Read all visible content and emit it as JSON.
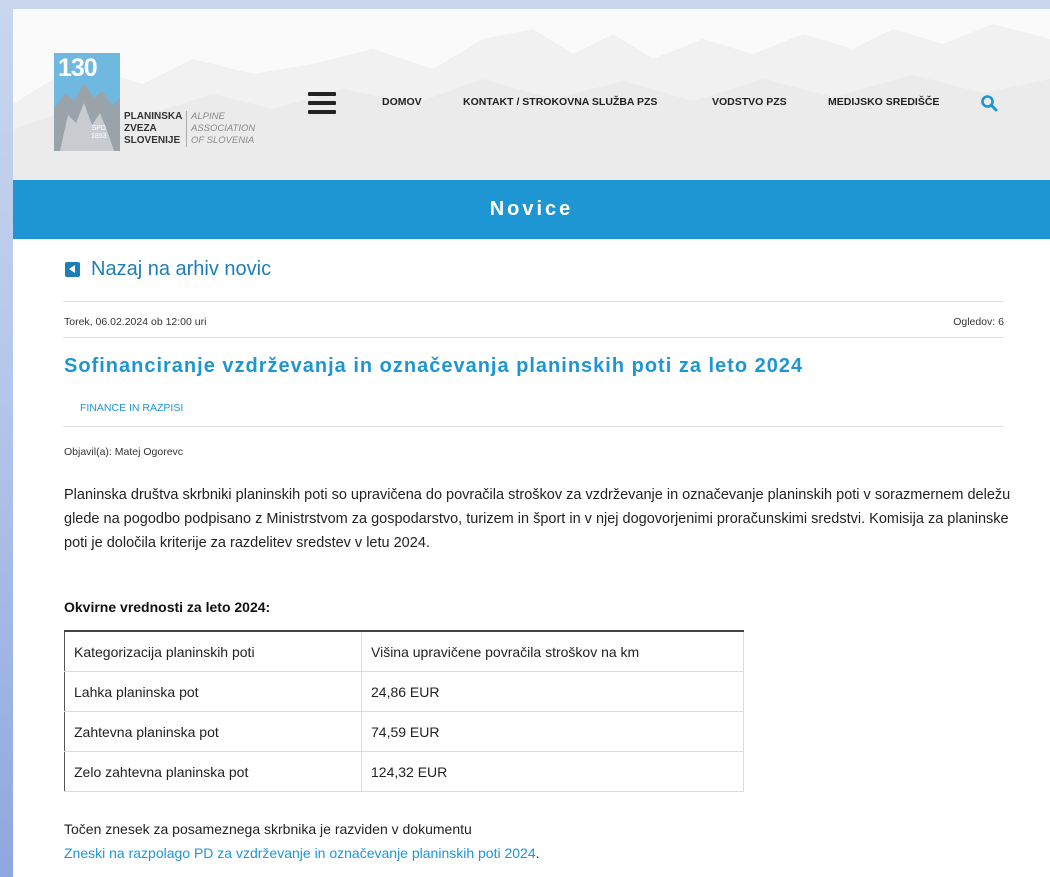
{
  "logo": {
    "number": "130",
    "spd": "SPD",
    "spd_year": "1893",
    "name_lines": [
      "PLANINSKA",
      "ZVEZA",
      "SLOVENIJE"
    ],
    "sub_lines": [
      "ALPINE",
      "ASSOCIATION",
      "OF SLOVENIA"
    ]
  },
  "nav": {
    "items": [
      "DOMOV",
      "KONTAKT / STROKOVNA SLUŽBA PZS",
      "VODSTVO PZS",
      "MEDIJSKO SREDIŠČE"
    ],
    "menu_icon": "hamburger-menu-icon",
    "search_icon": "search-icon"
  },
  "banner": {
    "title": "Novice"
  },
  "back_link": {
    "label": "Nazaj na arhiv novic",
    "icon": "caret-left-icon"
  },
  "article": {
    "date": "Torek, 06.02.2024 ob 12:00 uri",
    "views": "Ogledov: 6",
    "title": "Sofinanciranje vzdrževanja in označevanja planinskih poti za leto 2024",
    "category": "FINANCE IN RAZPISI",
    "author": "Objavil(a): Matej Ogorevc",
    "body": "Planinska društva skrbniki planinskih poti so upravičena do povračila stroškov za vzdrževanje in označevanje planinskih poti v sorazmernem deležu glede na pogodbo podpisano z Ministrstvom za gospodarstvo, turizem in šport in v njej dogovorjenimi proračunskimi sredstvi. Komisija za planinske poti je določila kriterije za razdelitev sredstev v letu 2024.",
    "subheading": "Okvirne vrednosti za leto 2024:",
    "table": {
      "rows": [
        [
          "Kategorizacija planinskih poti",
          "Višina upravičene povračila stroškov na km"
        ],
        [
          "Lahka planinska pot",
          "24,86 EUR"
        ],
        [
          "Zahtevna planinska pot",
          "74,59 EUR"
        ],
        [
          "Zelo zahtevna planinska pot",
          "124,32 EUR"
        ]
      ]
    },
    "footer_text": "Točen znesek za posameznega skrbnika je razviden v dokumentu",
    "footer_link": "Zneski na razpolago PD za vzdrževanje in označevanje planinskih poti 2024",
    "footer_end": "."
  },
  "colors": {
    "accent": "#1e96d4",
    "link_dark": "#1e7fb8",
    "logo_blue": "#6fb8e0"
  }
}
